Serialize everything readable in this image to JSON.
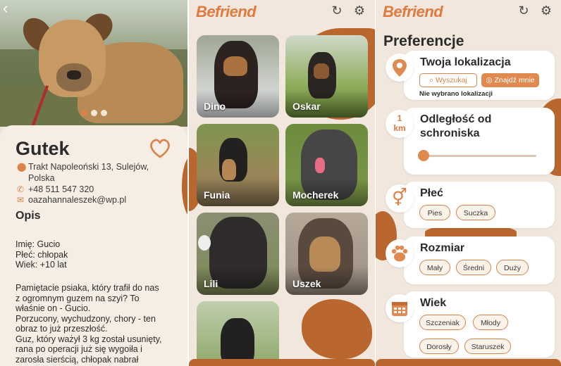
{
  "colors": {
    "accent": "#e07a3e",
    "accent_soft": "#d9824a",
    "brown": "#b9672f",
    "text": "#2b2b2b"
  },
  "detail": {
    "back_icon": "back-arrow-icon",
    "name": "Gutek",
    "address_line1": "Trakt Napoleoński 13, Sulejów,",
    "address_line2": "Polska",
    "phone": "+48 511 547 320",
    "email": "oazahannaleszek@wp.pl",
    "section_title": "Opis",
    "info_lines": [
      "Imię: Gucio",
      "Płeć: chłopak",
      "Wiek: +10 lat"
    ],
    "description_lines": [
      "Pamiętacie psiaka, który trafił do nas",
      "z ogromnym guzem na szyi? To",
      "właśnie on - Gucio.",
      "Porzucony, wychudzony, chory - ten",
      "obraz to już przeszłość.",
      "Guz, który ważył 3 kg został usunięty,",
      "rana po operacji już się wygoiła i",
      "zarosła sierścią, chłopak nabrał"
    ]
  },
  "list": {
    "logo": "Befriend",
    "dogs": [
      {
        "name": "Dino"
      },
      {
        "name": "Oskar"
      },
      {
        "name": "Funia"
      },
      {
        "name": "Mocherek"
      },
      {
        "name": "Lili"
      },
      {
        "name": "Uszek"
      },
      {
        "name": ""
      }
    ]
  },
  "prefs": {
    "logo": "Befriend",
    "title": "Preferencje",
    "location": {
      "title": "Twoja lokalizacja",
      "search_btn": "Wyszukaj",
      "find_btn": "Znajdź mnie",
      "note": "Nie wybrano lokalizacji"
    },
    "distance": {
      "value": "1",
      "unit": "km",
      "title_line1": "Odległość od",
      "title_line2": "schroniska",
      "slider_level": 0.0
    },
    "sex": {
      "title": "Płeć",
      "options": [
        "Pies",
        "Suczka"
      ]
    },
    "size": {
      "title": "Rozmiar",
      "options": [
        "Mały",
        "Średni",
        "Duży"
      ]
    },
    "age": {
      "title": "Wiek",
      "options": [
        "Szczeniak",
        "Młody",
        "Dorosły",
        "Staruszek"
      ]
    }
  }
}
